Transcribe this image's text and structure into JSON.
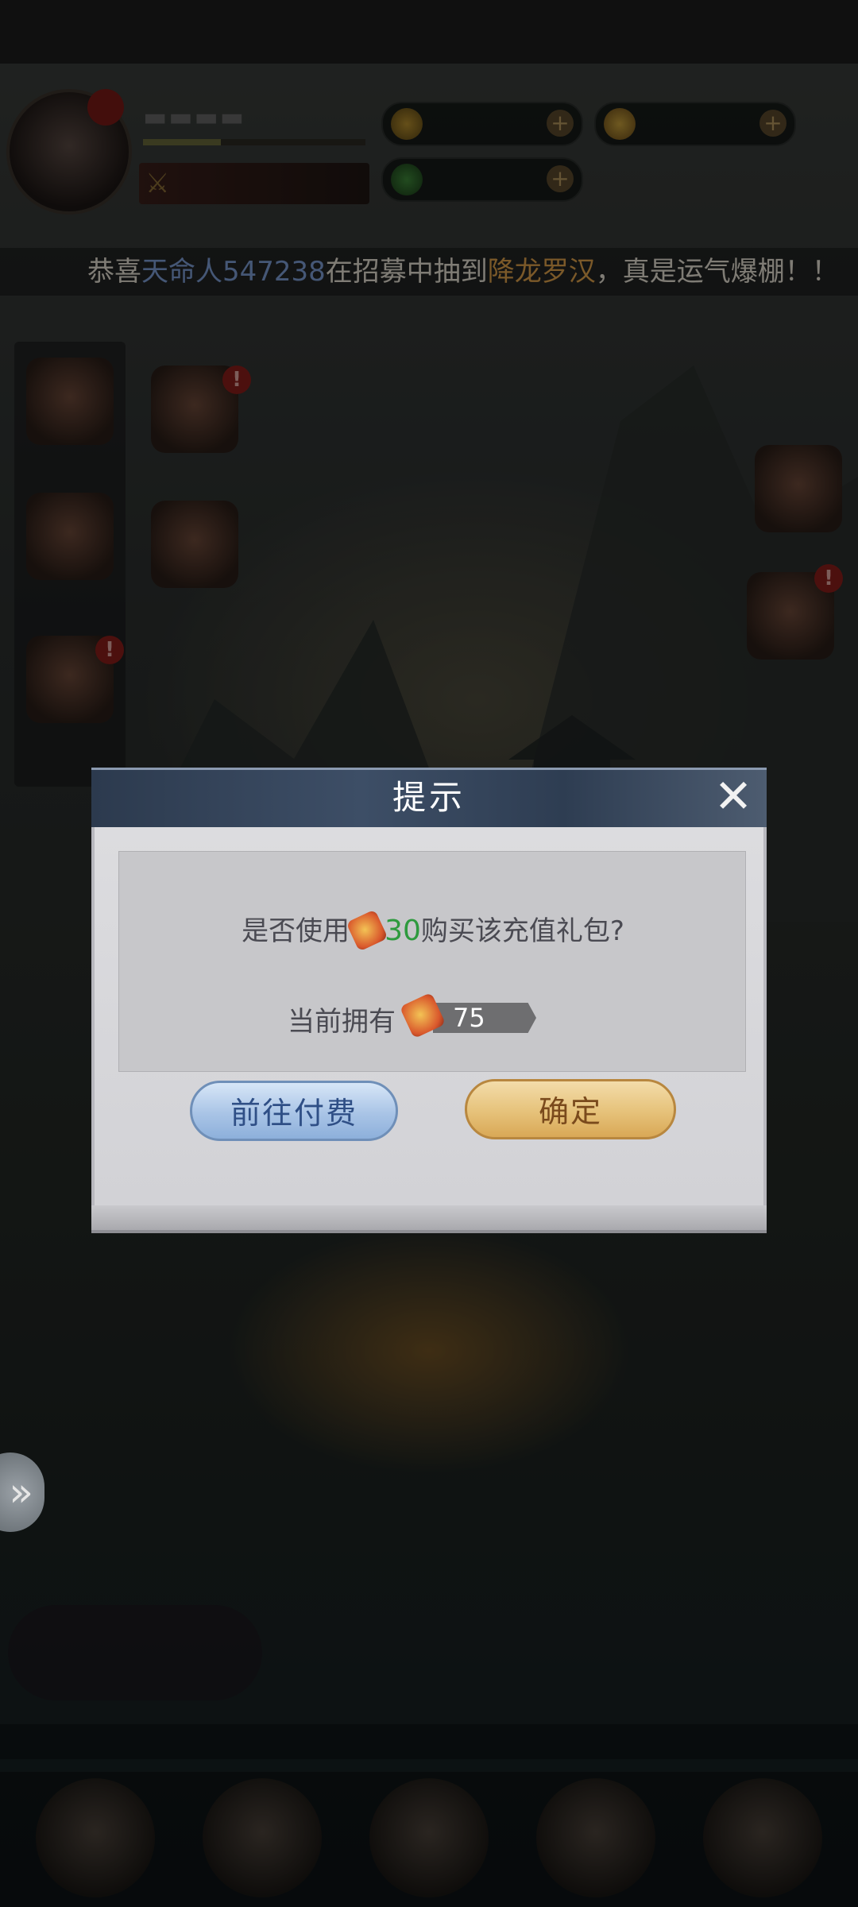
{
  "announcement": {
    "prefix": "恭喜",
    "player": "天命人547238",
    "middle": "在招募中抽到",
    "hero": "降龙罗汉",
    "suffix": "，真是运气爆棚！！"
  },
  "dialog": {
    "title": "提示",
    "close_icon": "close-icon",
    "question_prefix": "是否使用",
    "price": "30",
    "question_suffix": "购买该充值礼包?",
    "currency_icon": "recharge-token-icon",
    "owned_label": "当前拥有",
    "owned_value": "75",
    "cancel_label": "前往付费",
    "confirm_label": "确定"
  },
  "hud": {
    "side_expand_icon": "double-chevron-right-icon"
  },
  "colors": {
    "highlight_price": "#2e9a3e",
    "player_name": "#7f9fd8",
    "hero_name": "#e0a34c",
    "confirm_button": "#e6c27a",
    "cancel_button": "#a9c4e6"
  }
}
